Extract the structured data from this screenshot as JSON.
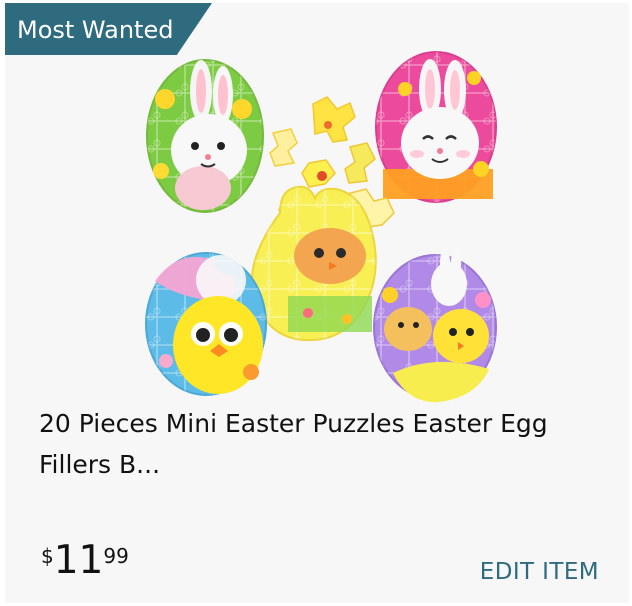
{
  "badge": {
    "label": "Most Wanted"
  },
  "product": {
    "image_description": "Five egg-shaped Easter jigsaw puzzles with bunnies and chicks",
    "title": "20 Pieces Mini Easter Puzzles Easter Egg Fillers B...",
    "price": {
      "symbol": "$",
      "whole": "11",
      "fraction": "99"
    }
  },
  "actions": {
    "edit_label": "EDIT ITEM"
  },
  "colors": {
    "badge_background": "#2f6b7f",
    "link": "#2f6b7f",
    "card_background": "#f7f7f7",
    "text": "#111111"
  }
}
